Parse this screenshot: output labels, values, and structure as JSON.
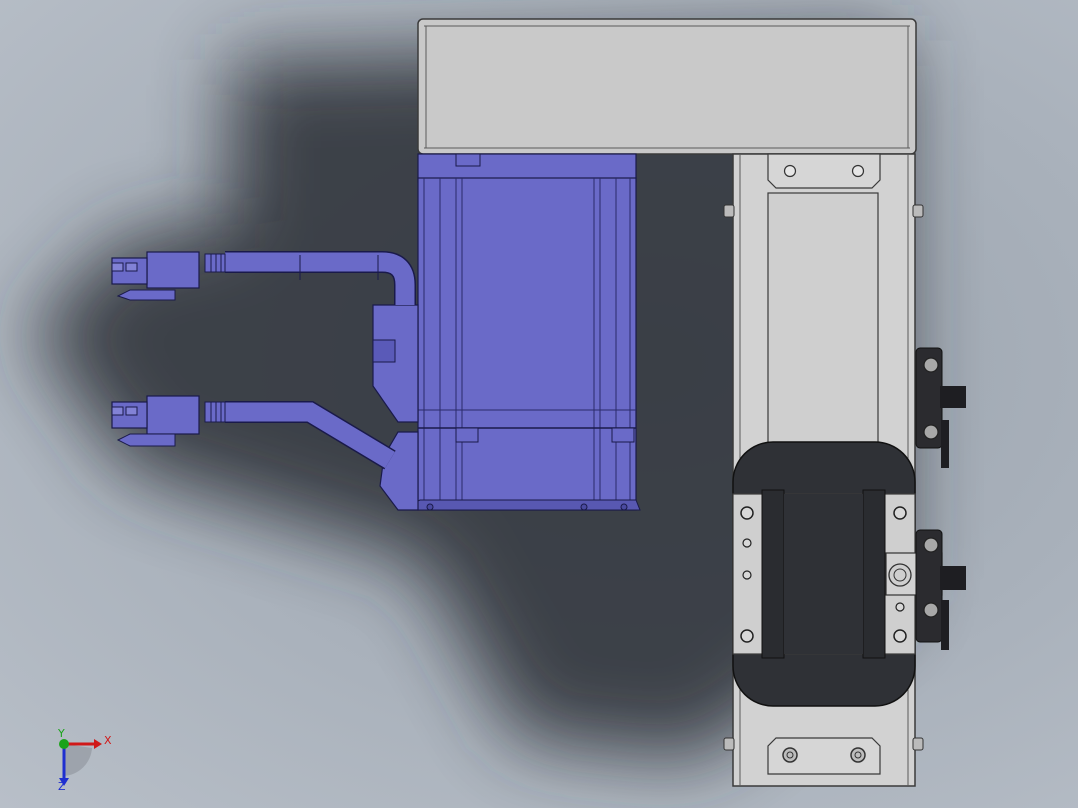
{
  "viewport": {
    "background_color": "#a9b1bb",
    "model_colors": {
      "motor": "#6a6ac8",
      "housing": "#c9c9c9",
      "carriage": "#2f3136",
      "bracket": "#1e1e22"
    }
  },
  "triad": {
    "x_label": "X",
    "y_label": "Y",
    "z_label": "Z",
    "x_color": "#d01818",
    "y_color": "#1aa31a",
    "z_color": "#1f2fd0"
  }
}
